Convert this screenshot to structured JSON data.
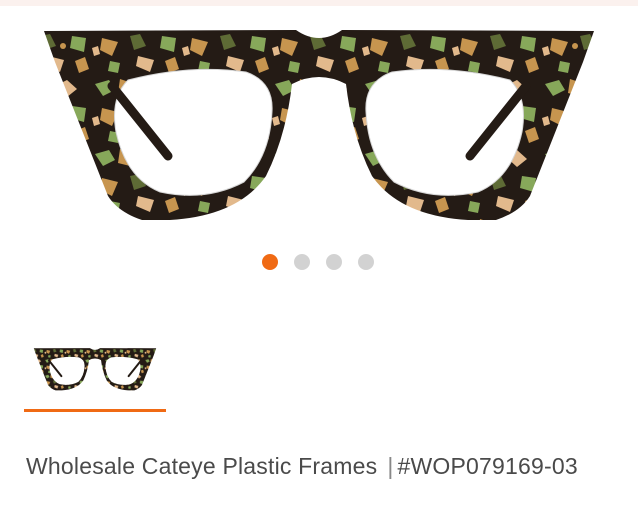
{
  "hero": {
    "image_name": "tortoise cat-eye glasses front view",
    "colors": {
      "dark": "#241b15",
      "green": "#87a85a",
      "amber": "#c7954f",
      "tan": "#e2b98c",
      "olive": "#5e6b35"
    }
  },
  "carousel": {
    "count": 4,
    "active_index": 0,
    "active_color": "#f06a14",
    "inactive_color": "#d2d2d2"
  },
  "thumbnails": [
    {
      "label": "tortoise frame front",
      "selected": true
    }
  ],
  "product": {
    "name": "Wholesale Cateye Plastic Frames",
    "separator": "|",
    "sku": "#WOP079169-03"
  }
}
